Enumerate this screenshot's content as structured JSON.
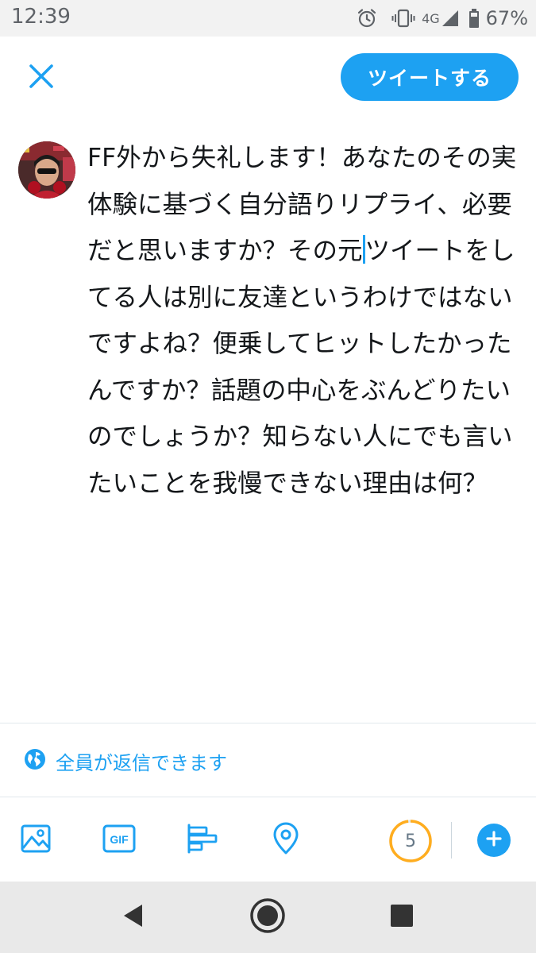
{
  "status_bar": {
    "time": "12:39",
    "network": "4G",
    "battery": "67%",
    "icons": [
      "alarm-icon",
      "vibrate-icon",
      "signal-icon",
      "battery-icon"
    ]
  },
  "header": {
    "close_icon": "close-icon",
    "tweet_button_label": "ツイートする"
  },
  "compose": {
    "text_before_cursor": "FF外から失礼します！あなたのその実体験に基づく自分語りリプライ、必要だと思いますか？その元",
    "text_after_cursor": "ツイートをしてる人は別に友達というわけではないですよね？便乗してヒットしたかったんですか？話題の中心をぶんどりたいのでしょうか？知らない人にでも言いたいことを我慢できない理由は何？"
  },
  "reply_setting": {
    "icon": "globe-icon",
    "label": "全員が返信できます"
  },
  "toolbar": {
    "icons": [
      "image-icon",
      "gif-icon",
      "poll-icon",
      "location-icon"
    ],
    "remaining_count": "5",
    "counter_fill_fraction": 0.98,
    "add_icon": "plus-icon"
  },
  "nav": {
    "icons": [
      "back-icon",
      "home-icon",
      "recents-icon"
    ]
  },
  "colors": {
    "accent": "#1da1f2",
    "warning": "#ffad1f",
    "text": "#14171a",
    "muted": "#657786"
  }
}
